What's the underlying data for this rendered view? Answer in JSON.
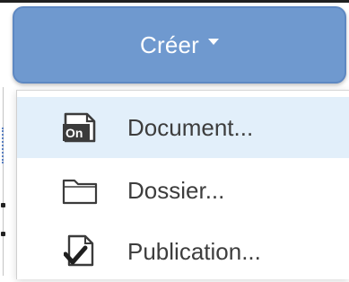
{
  "create_button": {
    "label": "Créer",
    "color": "#6f99cf"
  },
  "menu": {
    "items": [
      {
        "label": "Document...",
        "icon": "onenote-document-icon",
        "highlighted": true
      },
      {
        "label": "Dossier...",
        "icon": "folder-icon",
        "highlighted": false
      },
      {
        "label": "Publication...",
        "icon": "publish-check-icon",
        "highlighted": false
      }
    ],
    "highlight_color": "#e2effa"
  }
}
